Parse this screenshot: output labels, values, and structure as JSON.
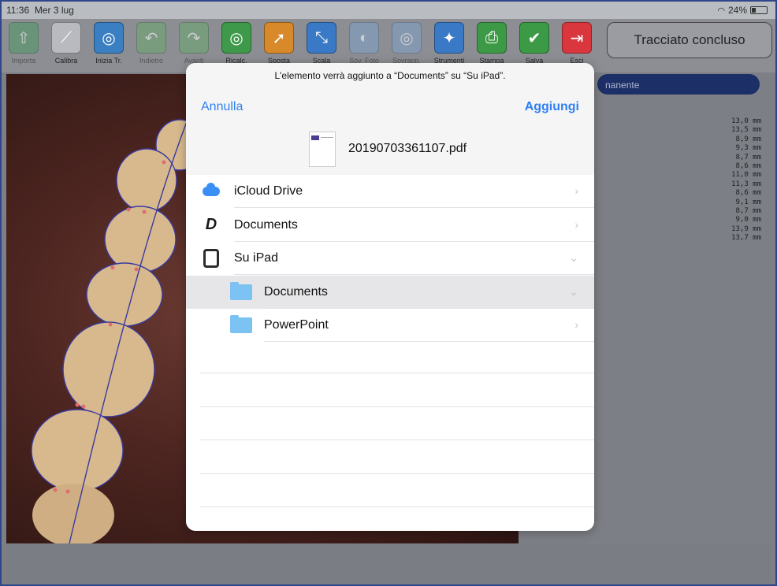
{
  "status_bar": {
    "time": "11:36",
    "date": "Mer 3 lug",
    "battery": "24%",
    "wifi_icon": "wifi-icon"
  },
  "toolbar": {
    "items": [
      {
        "label": "Importa",
        "icon": "import-icon",
        "color": "#4f9a64",
        "dim": true
      },
      {
        "label": "Calibra",
        "icon": "calibrate-icon",
        "color": "#b8bac0",
        "dim": false
      },
      {
        "label": "Inizia Tr.",
        "icon": "start-trace-icon",
        "color": "#3a7fc1",
        "dim": false
      },
      {
        "label": "Indietro",
        "icon": "undo-icon",
        "color": "#6aa66e",
        "dim": true
      },
      {
        "label": "Avanti",
        "icon": "redo-icon",
        "color": "#6aa66e",
        "dim": true
      },
      {
        "label": "Ricalc.",
        "icon": "recalc-icon",
        "color": "#3e9a4a",
        "dim": false
      },
      {
        "label": "Sposta",
        "icon": "move-icon",
        "color": "#d88a2a",
        "dim": false
      },
      {
        "label": "Scala",
        "icon": "scale-icon",
        "color": "#3a79c6",
        "dim": false
      },
      {
        "label": "Sov. Foto",
        "icon": "photo-overlay-icon",
        "color": "#7ea1c8",
        "dim": true
      },
      {
        "label": "Sovrapp.",
        "icon": "overlay-icon",
        "color": "#7ea1c8",
        "dim": true
      },
      {
        "label": "Strumenti",
        "icon": "tools-icon",
        "color": "#3a79c6",
        "dim": false
      },
      {
        "label": "Stampa",
        "icon": "print-icon",
        "color": "#3c9a46",
        "dim": false
      },
      {
        "label": "Salva",
        "icon": "save-icon",
        "color": "#3c9a46",
        "dim": false
      },
      {
        "label": "Esci",
        "icon": "exit-icon",
        "color": "#d9363e",
        "dim": false
      }
    ],
    "done_label": "Tracciato concluso"
  },
  "right_panel": {
    "tab_label": "nanente",
    "measurements": [
      "13,0 mm",
      "13,5 mm",
      "8,9 mm",
      "9,3 mm",
      "8,7 mm",
      "8,6 mm",
      "11,0 mm",
      "11,3 mm",
      "8,6 mm",
      "9,1 mm",
      "8,7 mm",
      "9,0 mm",
      "13,9 mm",
      "13,7 mm"
    ]
  },
  "share_sheet": {
    "notice": "L'elemento verrà aggiunto a “Documents” su “Su iPad”.",
    "cancel_label": "Annulla",
    "add_label": "Aggiungi",
    "file_name": "20190703361107.pdf",
    "locations": [
      {
        "label": "iCloud Drive",
        "icon": "icloud-icon",
        "chevron": "›",
        "sub": false,
        "selected": false
      },
      {
        "label": "Documents",
        "icon": "documents-app-icon",
        "chevron": "›",
        "sub": false,
        "selected": false
      },
      {
        "label": "Su iPad",
        "icon": "ipad-icon",
        "chevron": "⌄",
        "sub": false,
        "selected": false
      },
      {
        "label": "Documents",
        "icon": "folder-icon",
        "chevron": "⌄",
        "sub": true,
        "selected": true
      },
      {
        "label": "PowerPoint",
        "icon": "folder-icon",
        "chevron": "›",
        "sub": true,
        "selected": false
      }
    ]
  }
}
